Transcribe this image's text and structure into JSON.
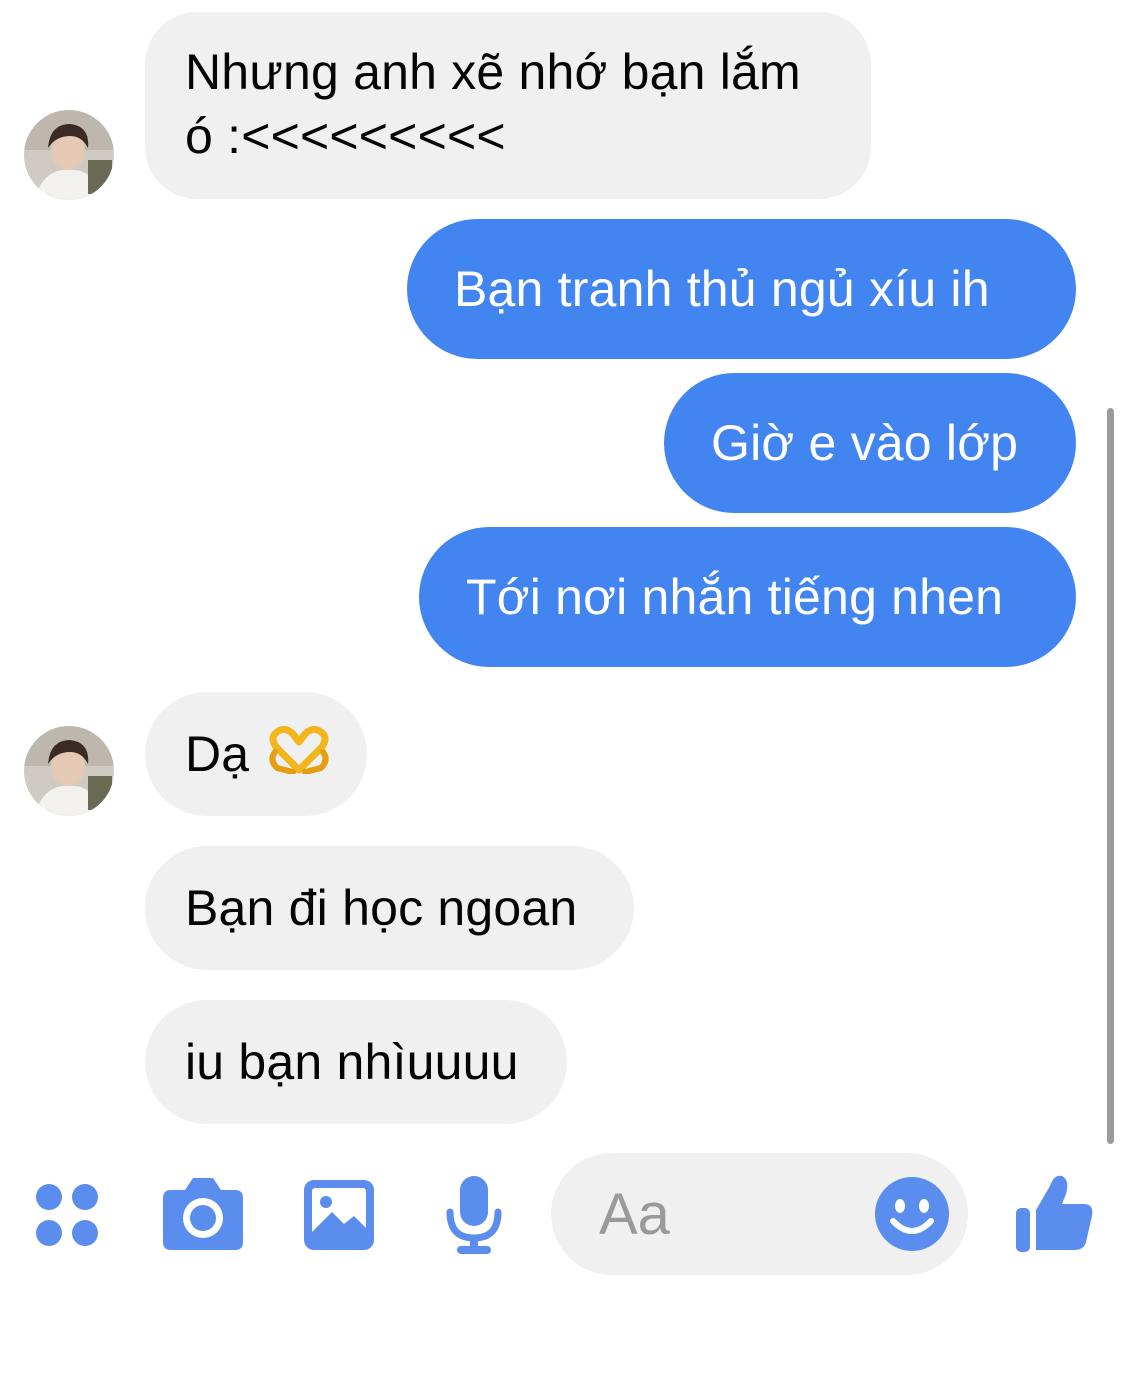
{
  "messages": [
    {
      "direction": "incoming",
      "text": "Nhưng anh xẽ nhớ bạn lắm ó :<<<<<<<<<",
      "line1": "Nhưng anh xẽ nhớ bạn lắm",
      "line2": "ó :<<<<<<<<<"
    },
    {
      "direction": "outgoing",
      "text": "Bạn tranh thủ ngủ xíu ih"
    },
    {
      "direction": "outgoing",
      "text": "Giờ e vào lớp"
    },
    {
      "direction": "outgoing",
      "text": "Tới nơi nhắn tiếng nhen"
    },
    {
      "direction": "incoming",
      "text": "Dạ",
      "emoji": "heart-hands"
    },
    {
      "direction": "incoming",
      "text": "Bạn đi học ngoan"
    },
    {
      "direction": "incoming",
      "text": "iu bạn nhìuuuu"
    }
  ],
  "composer": {
    "placeholder": "Aa",
    "icons": [
      "apps-icon",
      "camera-icon",
      "gallery-icon",
      "microphone-icon",
      "emoji-icon",
      "like-icon"
    ]
  },
  "colors": {
    "accent": "#4285f0",
    "incoming_bubble": "#f0f0f0",
    "icon_blue": "#5b8def"
  }
}
